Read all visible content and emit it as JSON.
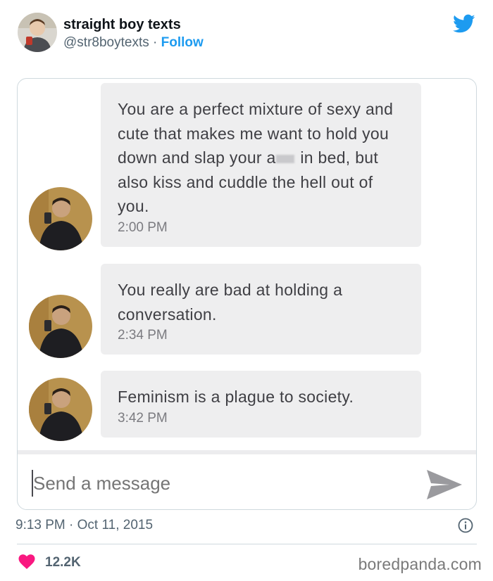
{
  "tweet": {
    "author_name": "straight boy texts",
    "handle": "@str8boytexts",
    "separator": " · ",
    "follow_label": "Follow",
    "timestamp": "9:13 PM · Oct 11, 2015",
    "like_count": "12.2K",
    "icons": [
      "twitter-bird-icon",
      "info-icon",
      "heart-icon"
    ],
    "brand_color": "#1d9bf0",
    "like_color": "#f91880"
  },
  "chat": {
    "messages": [
      {
        "text_before_censor": "You are a perfect mixture of sexy and cute that makes me want to hold you down and slap your a",
        "text_after_censor": " in bed, but also kiss and cuddle the hell out of you.",
        "time": "2:00 PM"
      },
      {
        "text": "You really are bad at holding a conversation.",
        "time": "2:34 PM"
      },
      {
        "text": "Feminism is a plague to society.",
        "time": "3:42 PM"
      }
    ],
    "composer_placeholder": "Send a message",
    "send_icon": "send-arrow-icon",
    "bubble_color": "#eeeeef"
  },
  "watermark": "boredpanda.com"
}
